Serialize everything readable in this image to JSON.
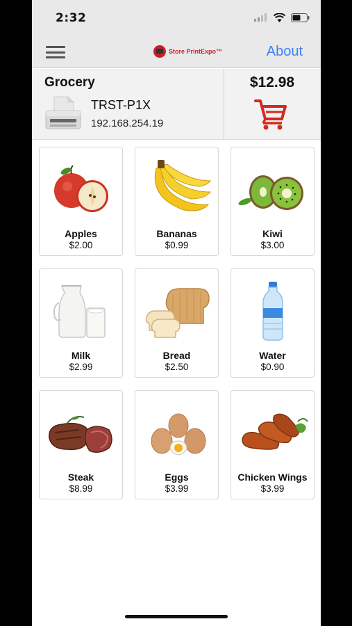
{
  "status_bar": {
    "time": "2:32"
  },
  "nav": {
    "logo_text": "Store PrintExpo™",
    "about_label": "About"
  },
  "header": {
    "store_name": "Grocery",
    "printer_name": "TRST-P1X",
    "printer_ip": "192.168.254.19",
    "total": "$12.98"
  },
  "colors": {
    "accent_blue": "#3b82f6",
    "cart_red": "#d42a1f",
    "brand_red": "#c8202a"
  },
  "products": [
    {
      "name": "Apples",
      "price": "$2.00",
      "icon": "apple-icon"
    },
    {
      "name": "Bananas",
      "price": "$0.99",
      "icon": "banana-icon"
    },
    {
      "name": "Kiwi",
      "price": "$3.00",
      "icon": "kiwi-icon"
    },
    {
      "name": "Milk",
      "price": "$2.99",
      "icon": "milk-icon"
    },
    {
      "name": "Bread",
      "price": "$2.50",
      "icon": "bread-icon"
    },
    {
      "name": "Water",
      "price": "$0.90",
      "icon": "water-bottle-icon"
    },
    {
      "name": "Steak",
      "price": "$8.99",
      "icon": "steak-icon"
    },
    {
      "name": "Eggs",
      "price": "$3.99",
      "icon": "eggs-icon"
    },
    {
      "name": "Chicken Wings",
      "price": "$3.99",
      "icon": "chicken-wings-icon"
    }
  ]
}
